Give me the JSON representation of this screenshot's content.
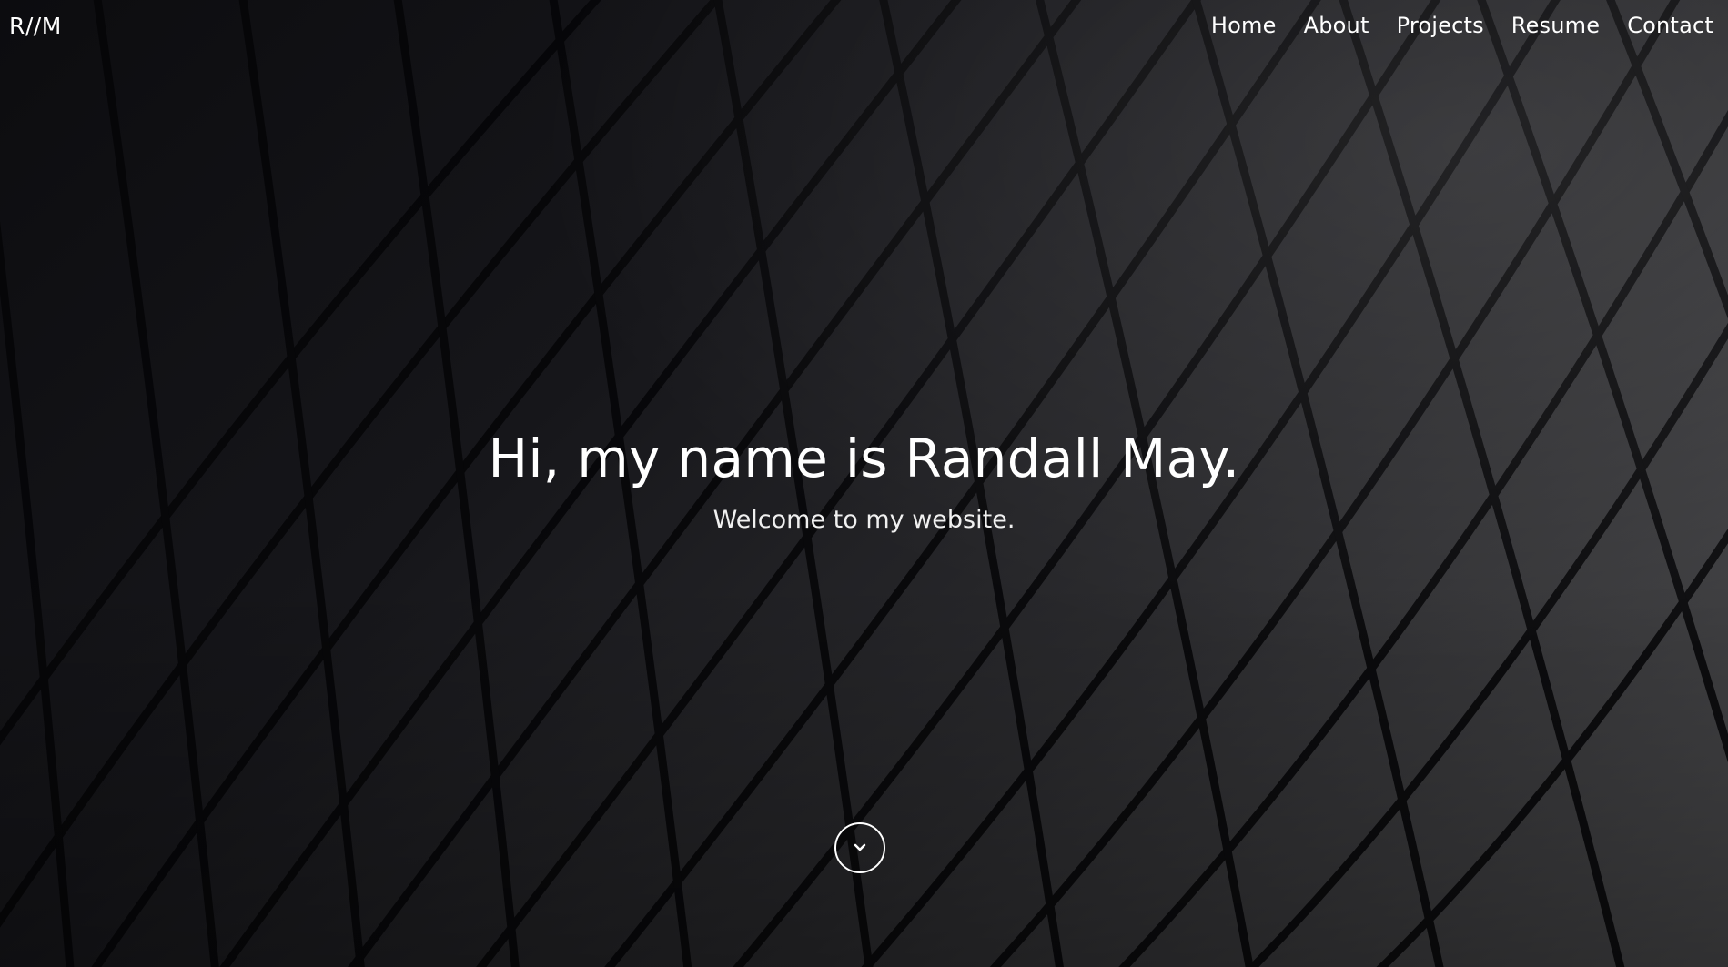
{
  "header": {
    "logo": "R//M",
    "nav": [
      {
        "label": "Home"
      },
      {
        "label": "About"
      },
      {
        "label": "Projects"
      },
      {
        "label": "Resume"
      },
      {
        "label": "Contact"
      }
    ]
  },
  "hero": {
    "title": "Hi, my name is Randall May.",
    "subtitle": "Welcome to my website.",
    "scroll_icon": "chevron-down-icon"
  },
  "colors": {
    "text": "#ffffff",
    "background_dark": "#0c0c0f",
    "background_light": "#4a4a4c"
  }
}
